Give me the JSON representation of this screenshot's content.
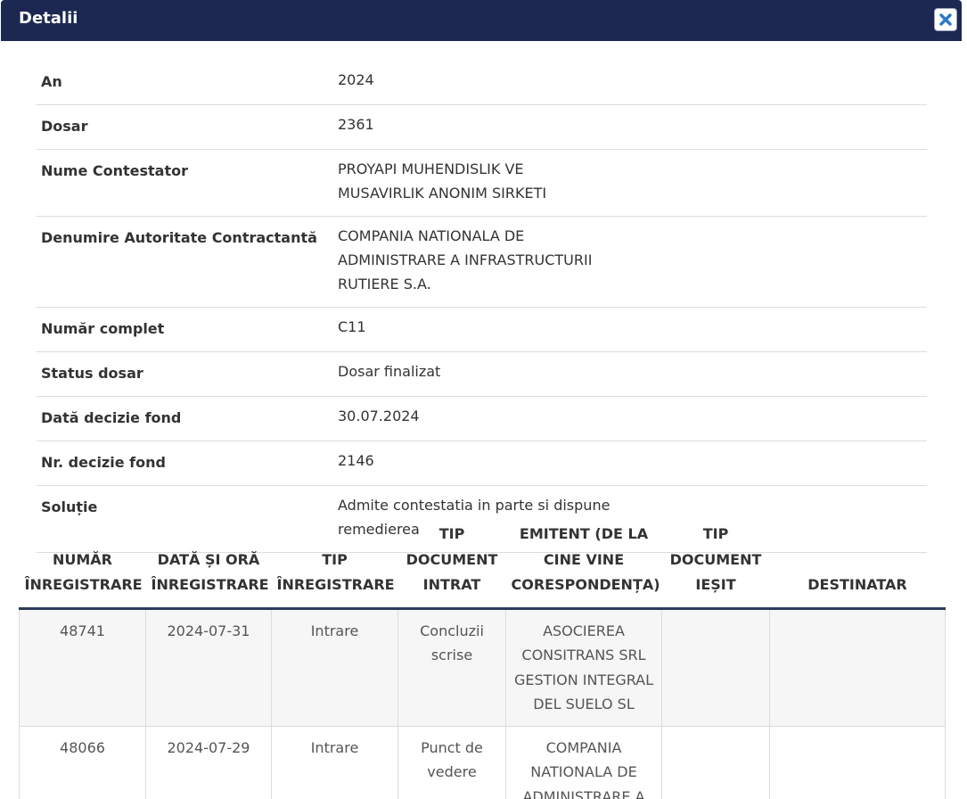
{
  "dialog": {
    "title": "Detalii",
    "close_icon": "close-icon"
  },
  "details": [
    {
      "label": "An",
      "value": "2024"
    },
    {
      "label": "Dosar",
      "value": "2361"
    },
    {
      "label": "Nume Contestator",
      "value": "PROYAPI MUHENDISLIK VE MUSAVIRLIK ANONIM SIRKETI"
    },
    {
      "label": "Denumire Autoritate Contractantă",
      "value": "COMPANIA NATIONALA DE ADMINISTRARE A INFRASTRUCTURII RUTIERE S.A."
    },
    {
      "label": "Număr complet",
      "value": "C11"
    },
    {
      "label": "Status dosar",
      "value": "Dosar finalizat"
    },
    {
      "label": "Dată decizie fond",
      "value": "30.07.2024"
    },
    {
      "label": "Nr. decizie fond",
      "value": "2146"
    },
    {
      "label": "Soluție",
      "value": "Admite contestatia in parte si dispune remedierea"
    }
  ],
  "registry": {
    "headers": [
      "NUMĂR ÎNREGISTRARE",
      "DATĂ ȘI ORĂ ÎNREGISTRARE",
      "TIP ÎNREGISTRARE",
      "TIP DOCUMENT INTRAT",
      "EMITENT (DE LA CINE VINE CORESPONDENȚA)",
      "TIP DOCUMENT IEȘIT",
      "DESTINATAR"
    ],
    "rows": [
      [
        "48741",
        "2024-07-31",
        "Intrare",
        "Concluzii scrise",
        "ASOCIEREA CONSITRANS SRL GESTION INTEGRAL DEL SUELO SL",
        "",
        ""
      ],
      [
        "48066",
        "2024-07-29",
        "Intrare",
        "Punct de vedere",
        "COMPANIA NATIONALA DE ADMINISTRARE A",
        "",
        ""
      ]
    ]
  }
}
